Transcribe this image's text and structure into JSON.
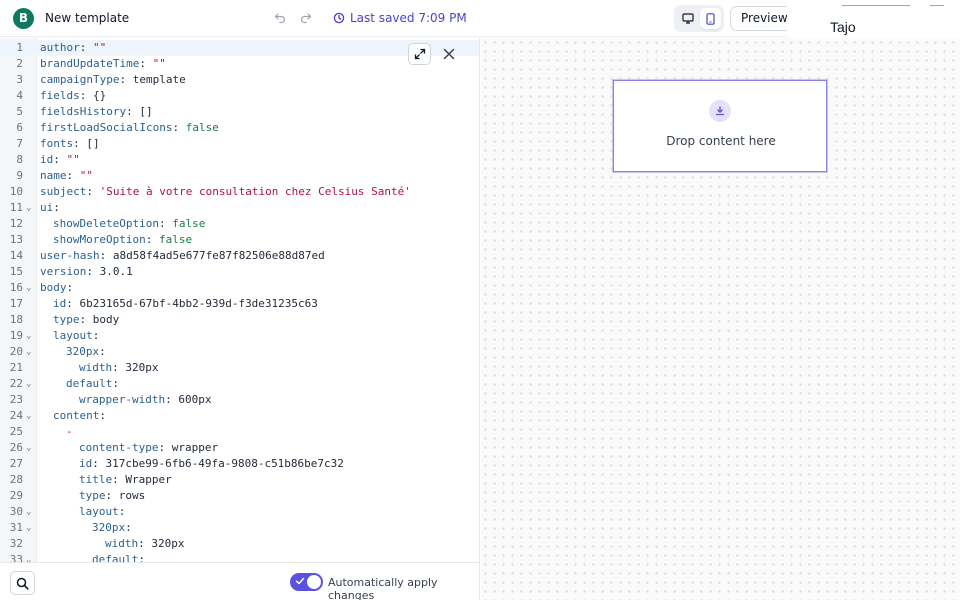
{
  "header": {
    "logo_letter": "B",
    "template_name": "New template",
    "saved_status": "Last saved 7:09 PM",
    "preview_label": "Preview",
    "popover_text": "Tajo"
  },
  "editor": {
    "lines": [
      {
        "n": "1",
        "indent": 0,
        "fold": false,
        "key": "author",
        "value": "\"\"",
        "vtype": "str"
      },
      {
        "n": "2",
        "indent": 0,
        "fold": false,
        "key": "brandUpdateTime",
        "value": "\"\"",
        "vtype": "str"
      },
      {
        "n": "3",
        "indent": 0,
        "fold": false,
        "key": "campaignType",
        "value": "template",
        "vtype": "plain"
      },
      {
        "n": "4",
        "indent": 0,
        "fold": false,
        "key": "fields",
        "value": "{}",
        "vtype": "plain"
      },
      {
        "n": "5",
        "indent": 0,
        "fold": false,
        "key": "fieldsHistory",
        "value": "[]",
        "vtype": "plain"
      },
      {
        "n": "6",
        "indent": 0,
        "fold": false,
        "key": "firstLoadSocialIcons",
        "value": "false",
        "vtype": "bool"
      },
      {
        "n": "7",
        "indent": 0,
        "fold": false,
        "key": "fonts",
        "value": "[]",
        "vtype": "plain"
      },
      {
        "n": "8",
        "indent": 0,
        "fold": false,
        "key": "id",
        "value": "\"\"",
        "vtype": "str"
      },
      {
        "n": "9",
        "indent": 0,
        "fold": false,
        "key": "name",
        "value": "\"\"",
        "vtype": "str"
      },
      {
        "n": "10",
        "indent": 0,
        "fold": false,
        "key": "subject",
        "value": "'Suite à votre consultation chez Celsius Santé'",
        "vtype": "str"
      },
      {
        "n": "11",
        "indent": 0,
        "fold": true,
        "key": "ui",
        "value": "",
        "vtype": "plain"
      },
      {
        "n": "12",
        "indent": 1,
        "fold": false,
        "key": "showDeleteOption",
        "value": "false",
        "vtype": "bool"
      },
      {
        "n": "13",
        "indent": 1,
        "fold": false,
        "key": "showMoreOption",
        "value": "false",
        "vtype": "bool"
      },
      {
        "n": "14",
        "indent": 0,
        "fold": false,
        "key": "user-hash",
        "value": "a8d58f4ad5e677fe87f82506e88d87ed",
        "vtype": "plain"
      },
      {
        "n": "15",
        "indent": 0,
        "fold": false,
        "key": "version",
        "value": "3.0.1",
        "vtype": "plain"
      },
      {
        "n": "16",
        "indent": 0,
        "fold": true,
        "key": "body",
        "value": "",
        "vtype": "plain"
      },
      {
        "n": "17",
        "indent": 1,
        "fold": false,
        "key": "id",
        "value": "6b23165d-67bf-4bb2-939d-f3de31235c63",
        "vtype": "plain"
      },
      {
        "n": "18",
        "indent": 1,
        "fold": false,
        "key": "type",
        "value": "body",
        "vtype": "plain"
      },
      {
        "n": "19",
        "indent": 1,
        "fold": true,
        "key": "layout",
        "value": "",
        "vtype": "plain"
      },
      {
        "n": "20",
        "indent": 2,
        "fold": true,
        "key": "320px",
        "value": "",
        "vtype": "plain"
      },
      {
        "n": "21",
        "indent": 3,
        "fold": false,
        "key": "width",
        "value": "320px",
        "vtype": "plain"
      },
      {
        "n": "22",
        "indent": 2,
        "fold": true,
        "key": "default",
        "value": "",
        "vtype": "plain"
      },
      {
        "n": "23",
        "indent": 3,
        "fold": false,
        "key": "wrapper-width",
        "value": "600px",
        "vtype": "plain"
      },
      {
        "n": "24",
        "indent": 1,
        "fold": true,
        "key": "content",
        "value": "",
        "vtype": "plain"
      },
      {
        "n": "25",
        "indent": 2,
        "fold": false,
        "key": "",
        "dash": "-",
        "value": "",
        "vtype": "plain"
      },
      {
        "n": "26",
        "indent": 3,
        "fold": true,
        "key": "content-type",
        "value": "wrapper",
        "vtype": "plain"
      },
      {
        "n": "27",
        "indent": 3,
        "fold": false,
        "key": "id",
        "value": "317cbe99-6fb6-49fa-9808-c51b86be7c32",
        "vtype": "plain"
      },
      {
        "n": "28",
        "indent": 3,
        "fold": false,
        "key": "title",
        "value": "Wrapper",
        "vtype": "plain"
      },
      {
        "n": "29",
        "indent": 3,
        "fold": false,
        "key": "type",
        "value": "rows",
        "vtype": "plain"
      },
      {
        "n": "30",
        "indent": 3,
        "fold": true,
        "key": "layout",
        "value": "",
        "vtype": "plain"
      },
      {
        "n": "31",
        "indent": 4,
        "fold": true,
        "key": "320px",
        "value": "",
        "vtype": "plain"
      },
      {
        "n": "32",
        "indent": 5,
        "fold": false,
        "key": "width",
        "value": "320px",
        "vtype": "plain"
      },
      {
        "n": "33",
        "indent": 4,
        "fold": true,
        "key": "default",
        "value": "",
        "vtype": "plain"
      }
    ]
  },
  "footer": {
    "auto_apply_label": "Automatically apply changes",
    "auto_apply_on": true
  },
  "canvas": {
    "drop_text": "Drop content here"
  },
  "colors": {
    "brand": "#0e7a5f",
    "accent": "#5b50e0",
    "saved_text": "#4b43c9"
  }
}
